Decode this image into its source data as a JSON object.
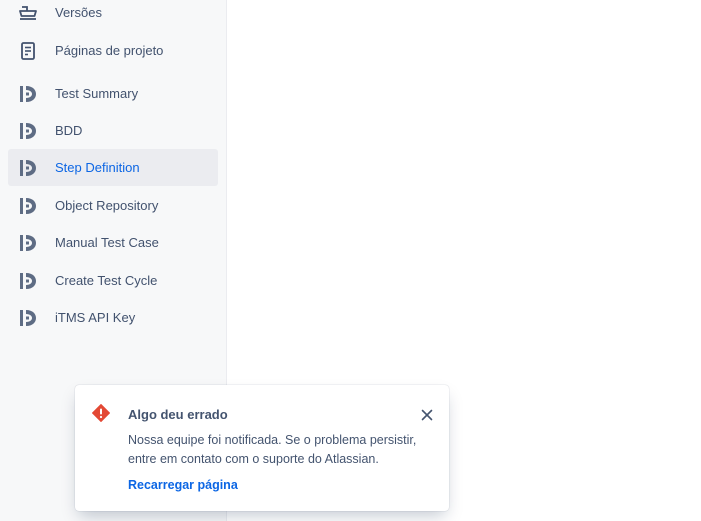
{
  "sidebar": {
    "items": [
      {
        "label": "Versões",
        "icon": "ship-icon",
        "active": false
      },
      {
        "label": "Páginas de projeto",
        "icon": "page-icon",
        "active": false
      },
      {
        "label": "Test Summary",
        "icon": "itms-app-icon",
        "active": false
      },
      {
        "label": "BDD",
        "icon": "itms-app-icon",
        "active": false
      },
      {
        "label": "Step Definition",
        "icon": "itms-app-icon",
        "active": true
      },
      {
        "label": "Object Repository",
        "icon": "itms-app-icon",
        "active": false
      },
      {
        "label": "Manual Test Case",
        "icon": "itms-app-icon",
        "active": false
      },
      {
        "label": "Create Test Cycle",
        "icon": "itms-app-icon",
        "active": false
      },
      {
        "label": "iTMS API Key",
        "icon": "itms-app-icon",
        "active": false
      }
    ]
  },
  "flag": {
    "title": "Algo deu errado",
    "body": "Nossa equipe foi notificada. Se o problema persistir, entre em contato com o suporte do Atlassian.",
    "action": "Recarregar página",
    "icon": "error-icon",
    "close_icon": "close-icon"
  },
  "colors": {
    "accent": "#0c66e4",
    "error": "#e34935",
    "text": "#44546f",
    "sidebar_bg": "#f7f8f9",
    "active_bg": "#ebecf0"
  }
}
